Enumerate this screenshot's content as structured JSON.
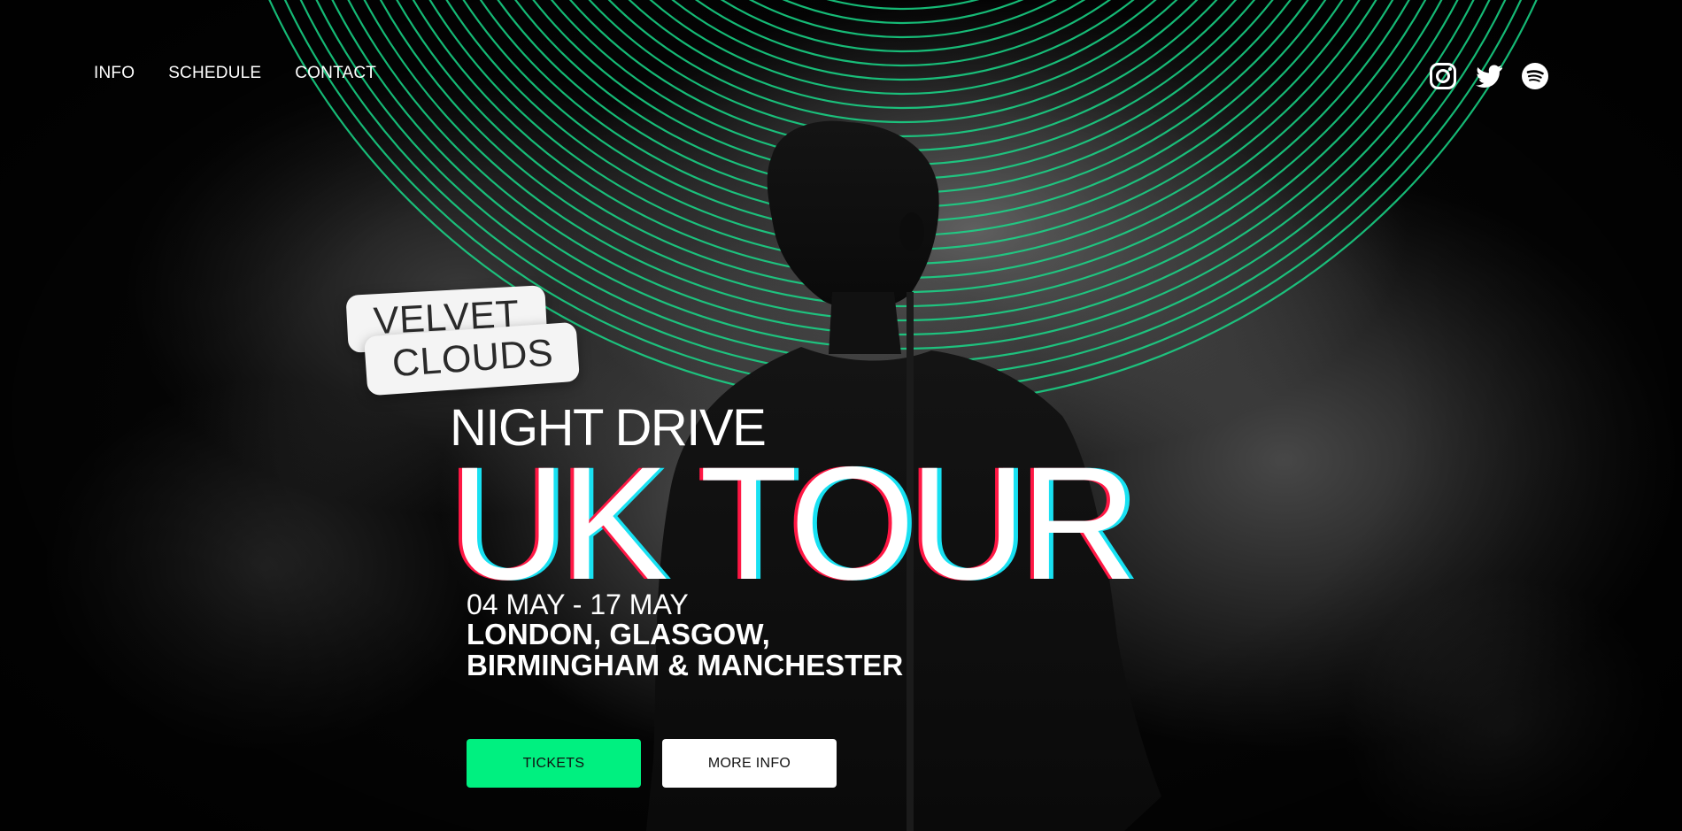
{
  "nav": {
    "items": [
      {
        "label": "INFO"
      },
      {
        "label": "SCHEDULE"
      },
      {
        "label": "CONTACT"
      }
    ]
  },
  "social": {
    "icons": [
      "instagram-icon",
      "twitter-icon",
      "spotify-icon"
    ]
  },
  "band": {
    "line1": "VELVET",
    "line2": "CLOUDS"
  },
  "hero": {
    "subtitle": "NIGHT DRIVE",
    "headline": "UK TOUR",
    "dates": "04 MAY - 17 MAY",
    "cities_line1": "LONDON, GLASGOW,",
    "cities_line2": "BIRMINGHAM & MANCHESTER"
  },
  "buttons": {
    "tickets": "TICKETS",
    "more_info": "MORE INFO"
  },
  "colors": {
    "accent": "#00f080",
    "ring": "#19d98a",
    "glitch_red": "#ff1744",
    "glitch_cyan": "#18e1f2"
  }
}
